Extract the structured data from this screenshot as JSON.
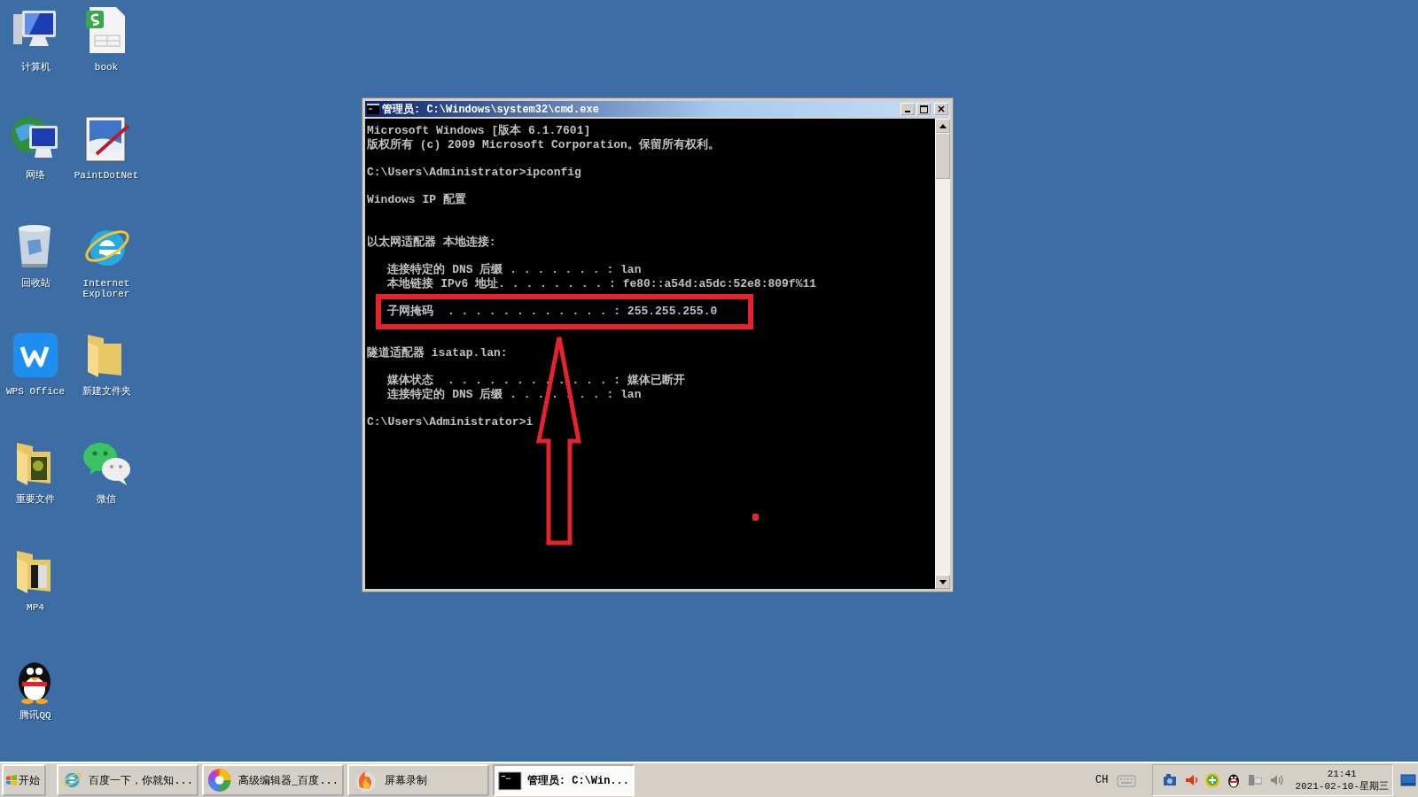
{
  "desktop": {
    "icons": [
      {
        "label": "计算机"
      },
      {
        "label": "网络"
      },
      {
        "label": "回收站"
      },
      {
        "label": "WPS Office"
      },
      {
        "label": "重要文件"
      },
      {
        "label": "MP4"
      },
      {
        "label": "腾讯QQ"
      },
      {
        "label": "book"
      },
      {
        "label": "PaintDotNet"
      },
      {
        "label": "Internet Explorer"
      },
      {
        "label": "新建文件夹"
      },
      {
        "label": "微信"
      }
    ]
  },
  "console_window": {
    "title": "管理员: C:\\Windows\\system32\\cmd.exe",
    "lines": [
      {
        "kind": "text",
        "text": "Microsoft Windows [版本 6.1.7601]"
      },
      {
        "kind": "text",
        "text": "版权所有 (c) 2009 Microsoft Corporation。保留所有权利。"
      },
      {
        "kind": "blank"
      },
      {
        "kind": "text",
        "text": "C:\\Users\\Administrator>ipconfig"
      },
      {
        "kind": "blank"
      },
      {
        "kind": "text",
        "text": "Windows IP 配置"
      },
      {
        "kind": "blank"
      },
      {
        "kind": "blank"
      },
      {
        "kind": "text",
        "text": "以太网适配器 本地连接:"
      },
      {
        "kind": "blank"
      },
      {
        "kind": "text",
        "text": "   连接特定的 DNS 后缀 . . . . . . . : lan"
      },
      {
        "kind": "text",
        "text": "   本地链接 IPv6 地址. . . . . . . . : fe80::a54d:a5dc:52e8:809f%11"
      },
      {
        "kind": "blank"
      },
      {
        "kind": "text",
        "text": "   子网掩码  . . . . . . . . . . . . : 255.255.255.0"
      },
      {
        "kind": "blank"
      },
      {
        "kind": "blank"
      },
      {
        "kind": "text",
        "text": "隧道适配器 isatap.lan:"
      },
      {
        "kind": "blank"
      },
      {
        "kind": "text",
        "text": "   媒体状态  . . . . . . . . . . . . : 媒体已断开"
      },
      {
        "kind": "text",
        "text": "   连接特定的 DNS 后缀 . . . . . . . : lan"
      },
      {
        "kind": "blank"
      },
      {
        "kind": "text",
        "text": "C:\\Users\\Administrator>i"
      }
    ]
  },
  "taskbar": {
    "start": {
      "label": "开始"
    },
    "tasks": [
      {
        "label": "百度一下，你就知...",
        "selected": false
      },
      {
        "label": "高级编辑器_百度...",
        "selected": false
      },
      {
        "label": "屏幕录制",
        "selected": false
      },
      {
        "label": "管理员: C:\\Win...",
        "selected": true
      }
    ],
    "tray": {
      "language": "CH",
      "time": "21:41",
      "date": "2021-02-10-星期三"
    }
  }
}
